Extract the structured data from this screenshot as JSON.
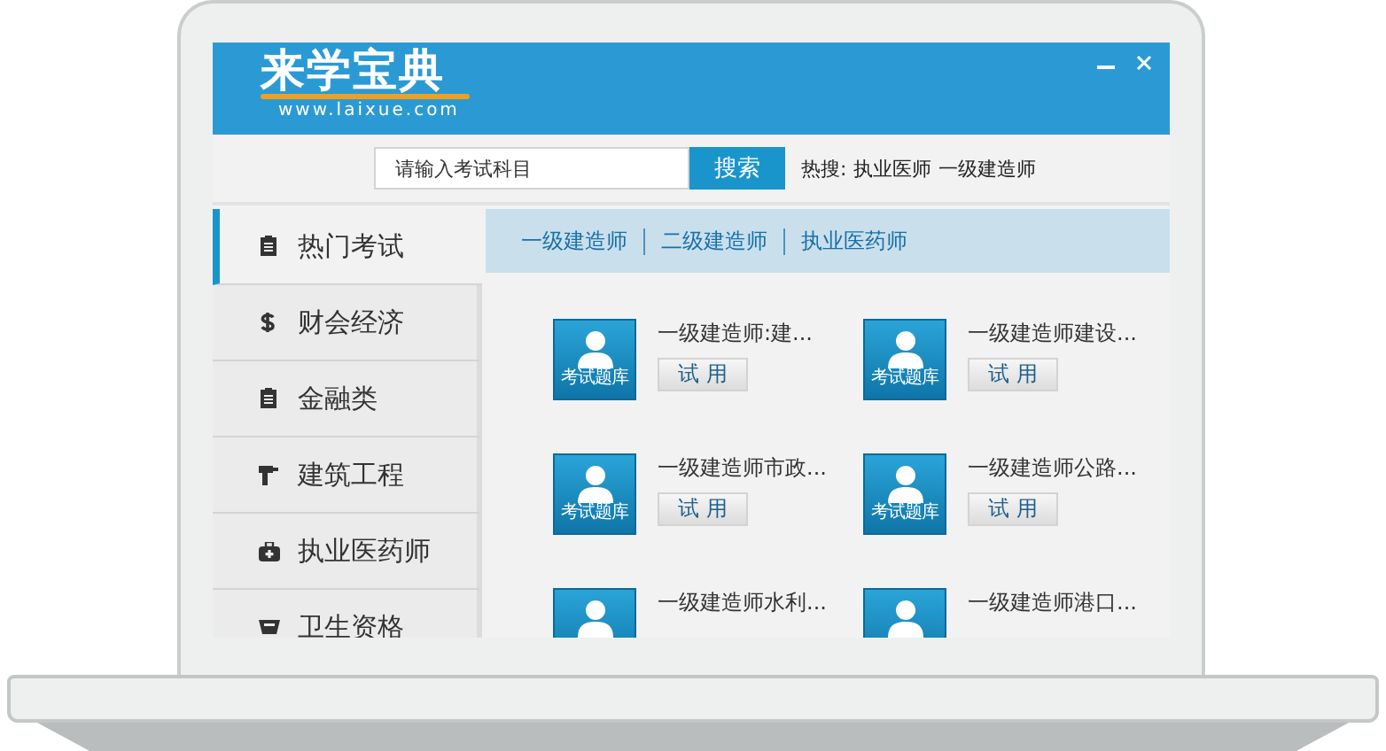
{
  "header": {
    "logo": "来学宝典",
    "logo_url": "www.laixue.com"
  },
  "search": {
    "placeholder": "请输入考试科目",
    "button": "搜索",
    "hot_label": "热搜:",
    "hot_terms": [
      "执业医师",
      "一级建造师"
    ]
  },
  "sidebar": {
    "items": [
      {
        "label": "热门考试",
        "selected": true
      },
      {
        "label": "财会经济",
        "selected": false
      },
      {
        "label": "金融类",
        "selected": false
      },
      {
        "label": "建筑工程",
        "selected": false
      },
      {
        "label": "执业医药师",
        "selected": false
      },
      {
        "label": "卫生资格",
        "selected": false
      }
    ]
  },
  "tabs": [
    {
      "label": "一级建造师"
    },
    {
      "label": "二级建造师"
    },
    {
      "label": "执业医药师"
    }
  ],
  "cards": [
    {
      "tile_label": "考试题库",
      "title": "一级建造师:建...",
      "button": "试 用"
    },
    {
      "tile_label": "考试题库",
      "title": "一级建造师建设...",
      "button": "试 用"
    },
    {
      "tile_label": "考试题库",
      "title": "一级建造师市政...",
      "button": "试 用"
    },
    {
      "tile_label": "考试题库",
      "title": "一级建造师公路...",
      "button": "试 用"
    },
    {
      "title": "一级建造师水利..."
    },
    {
      "title": "一级建造师港口..."
    }
  ]
}
